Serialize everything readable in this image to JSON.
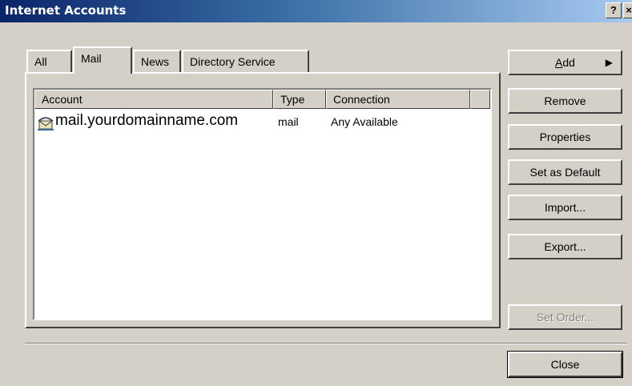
{
  "window": {
    "title": "Internet Accounts",
    "help_label": "?",
    "close_label": "×"
  },
  "tabs": [
    {
      "label": "All",
      "active": false
    },
    {
      "label": "Mail",
      "active": true
    },
    {
      "label": "News",
      "active": false
    },
    {
      "label": "Directory Service",
      "active": false
    }
  ],
  "list": {
    "columns": [
      "Account",
      "Type",
      "Connection",
      ""
    ],
    "rows": [
      {
        "account": "mail.yourdomainname.com",
        "type": "mail",
        "connection": "Any Available",
        "icon": "mail-account-icon"
      }
    ]
  },
  "buttons": {
    "add": {
      "prefix": "",
      "accel": "A",
      "rest": "dd",
      "arrow": "▶"
    },
    "remove": "Remove",
    "properties": "Properties",
    "set_default": "Set as Default",
    "import": "Import...",
    "export": "Export...",
    "set_order": "Set Order...",
    "close": "Close"
  },
  "colors": {
    "title_bar_start": "#0a246a",
    "title_bar_end": "#a6caf0",
    "face": "#d4d0c8"
  }
}
